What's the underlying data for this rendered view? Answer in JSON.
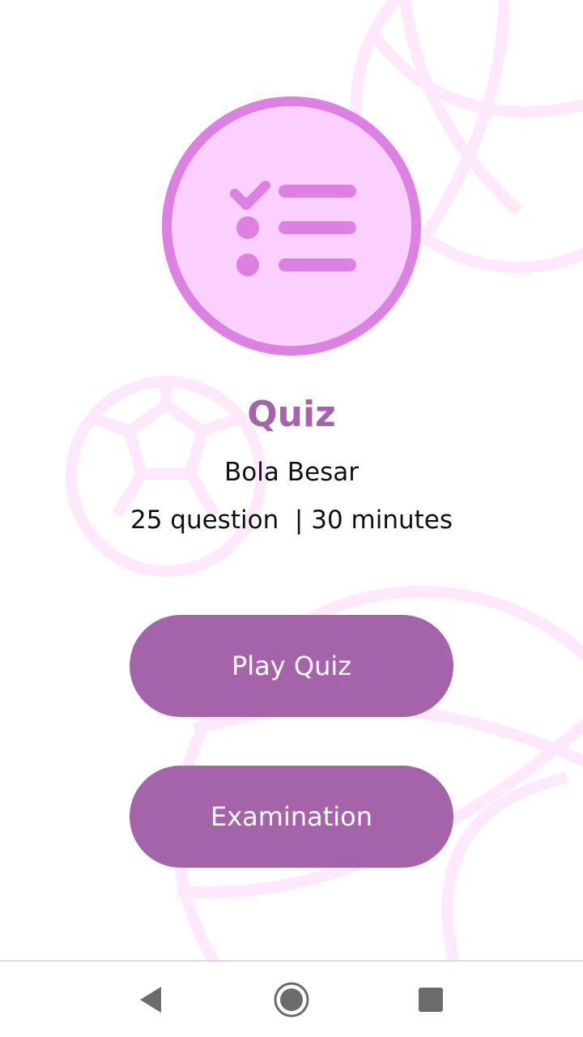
{
  "screen": {
    "title": "Quiz",
    "subtitle": "Bola Besar",
    "meta": "25 question  | 30 minutes",
    "hero_icon": "checklist-icon"
  },
  "actions": {
    "play_label": "Play Quiz",
    "exam_label": "Examination"
  },
  "nav": {
    "back_icon": "back-triangle-icon",
    "home_icon": "home-circle-icon",
    "recent_icon": "recent-square-icon"
  },
  "colors": {
    "accent": "#a564a9",
    "icon_circle_fill": "#fbd0ff",
    "icon_circle_border": "#dc80e2",
    "background_decoration": "#fde9fb"
  }
}
